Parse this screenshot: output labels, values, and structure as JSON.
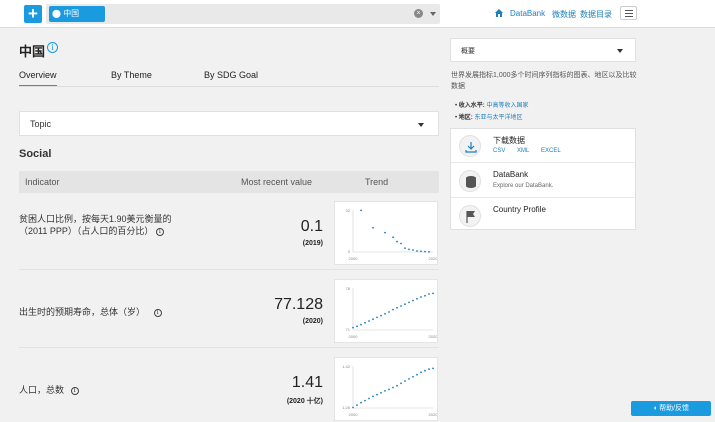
{
  "header": {
    "search_chip": "中国",
    "nav": [
      "DataBank",
      "微数据",
      "数据目录"
    ]
  },
  "country": {
    "title": "中国",
    "tabs": [
      "Overview",
      "By Theme",
      "By SDG Goal"
    ]
  },
  "topic_select": "Topic",
  "section_title": "Social",
  "table": {
    "headers": [
      "Indicator",
      "Most recent value",
      "Trend"
    ],
    "rows": [
      {
        "label": "贫困人口比例，按每天1.90美元衡量的（2011 PPP）（占人口的百分比）",
        "value": "0.1",
        "year": "(2019)",
        "y_top": "32",
        "y_bottom": "0",
        "x_start": "2000",
        "x_end": "2020"
      },
      {
        "label": "出生时的预期寿命，总体（岁）",
        "value": "77.128",
        "year": "(2020)",
        "y_top": "78",
        "y_bottom": "71",
        "x_start": "2000",
        "x_end": "2020"
      },
      {
        "label": "人口，总数",
        "value": "1.41",
        "year": "(2020 十亿)",
        "y_top": "1.42",
        "y_bottom": "1.26",
        "x_start": "2000",
        "x_end": "2020"
      }
    ]
  },
  "chart_data": [
    {
      "type": "scatter",
      "title": "",
      "x": [
        2002,
        2005,
        2008,
        2010,
        2011,
        2012,
        2013,
        2014,
        2015,
        2016,
        2017,
        2018,
        2019
      ],
      "values": [
        31.7,
        18.5,
        14.8,
        11.2,
        7.9,
        6.5,
        3.0,
        2.0,
        1.5,
        0.8,
        0.5,
        0.3,
        0.1
      ],
      "xlim": [
        2000,
        2020
      ],
      "ylim": [
        0,
        32
      ]
    },
    {
      "type": "scatter",
      "title": "",
      "x": [
        2000,
        2001,
        2002,
        2003,
        2004,
        2005,
        2006,
        2007,
        2008,
        2009,
        2010,
        2011,
        2012,
        2013,
        2014,
        2015,
        2016,
        2017,
        2018,
        2019,
        2020
      ],
      "values": [
        71.4,
        71.6,
        71.9,
        72.2,
        72.5,
        72.8,
        73.1,
        73.4,
        73.7,
        74.0,
        74.4,
        74.7,
        75.0,
        75.3,
        75.6,
        75.9,
        76.2,
        76.5,
        76.7,
        77.0,
        77.1
      ],
      "xlim": [
        2000,
        2020
      ],
      "ylim": [
        71,
        78
      ]
    },
    {
      "type": "scatter",
      "title": "",
      "x": [
        2000,
        2001,
        2002,
        2003,
        2004,
        2005,
        2006,
        2007,
        2008,
        2009,
        2010,
        2011,
        2012,
        2013,
        2014,
        2015,
        2016,
        2017,
        2018,
        2019,
        2020
      ],
      "values": [
        1.262,
        1.271,
        1.28,
        1.288,
        1.296,
        1.304,
        1.311,
        1.318,
        1.325,
        1.331,
        1.338,
        1.345,
        1.354,
        1.363,
        1.371,
        1.379,
        1.387,
        1.396,
        1.402,
        1.408,
        1.411
      ],
      "xlim": [
        2000,
        2020
      ],
      "ylim": [
        1.26,
        1.42
      ]
    }
  ],
  "sidebar": {
    "select": "概要",
    "description": "世界发展指标1,000多个时间序列指标的图表、地区以及比较数据",
    "income_label": "收入水平:",
    "income_value": "中高等收入国家",
    "region_label": "地区:",
    "region_value": "东亚与太平洋地区",
    "cards": [
      {
        "title": "下载数据",
        "links": [
          "CSV",
          "XML",
          "EXCEL"
        ]
      },
      {
        "title": "DataBank",
        "subtitle": "Explore our DataBank."
      },
      {
        "title": "Country Profile"
      }
    ]
  },
  "help_button": "帮助/反馈",
  "colors": {
    "accent": "#1a9bdf",
    "link": "#1a7fc1"
  }
}
